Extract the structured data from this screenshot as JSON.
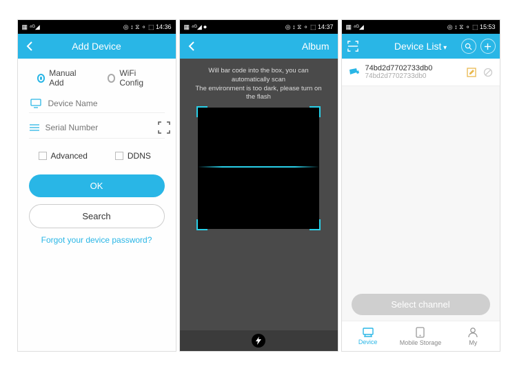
{
  "screen1": {
    "status": {
      "left": "▦ ⁴ᴳ◢",
      "right": "◎ ↕ ⧖ ⚬ ⬚ 14:36"
    },
    "title": "Add Device",
    "tabs": {
      "manual": "Manual Add",
      "wifi": "WiFi Config"
    },
    "fields": {
      "name_ph": "Device Name",
      "serial_ph": "Serial Number"
    },
    "checks": {
      "advanced": "Advanced",
      "ddns": "DDNS"
    },
    "buttons": {
      "ok": "OK",
      "search": "Search"
    },
    "forgot": "Forgot your device password?"
  },
  "screen2": {
    "status": {
      "left": "▦ ⁴ᴳ◢ ⏺",
      "right": "◎ ↕ ⧖ ⚬ ⬚ 14:37"
    },
    "title": "Album",
    "hint1": "Will bar code into the box, you can automatically scan",
    "hint2": "The environment is too dark, please turn on the flash"
  },
  "screen3": {
    "status": {
      "left": "▦ ⁴ᴳ◢",
      "right": "◎ ↕ ⧖ ⚬ ⬚ 15:53"
    },
    "title": "Device List",
    "device": {
      "id": "74bd2d7702733db0",
      "sub": "74bd2d7702733db0"
    },
    "select_channel": "Select channel",
    "tabs": {
      "device": "Device",
      "storage": "Mobile Storage",
      "my": "My"
    }
  }
}
